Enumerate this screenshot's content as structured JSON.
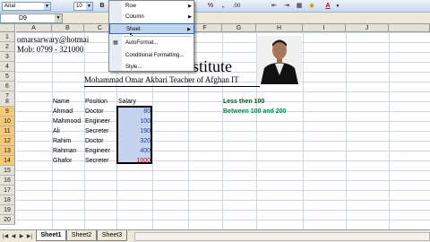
{
  "toolbar": {
    "font_name": "Arial",
    "font_size": "10",
    "currency_symbol": "%",
    "buttons": [
      "%",
      ",",
      ".00",
      "B",
      "A"
    ]
  },
  "formula_bar": {
    "cell_ref": "D9"
  },
  "columns": [
    "A",
    "B",
    "C",
    "D",
    "E",
    "F",
    "G",
    "H",
    "I",
    "J"
  ],
  "rows": [
    "1",
    "2",
    "3",
    "4",
    "5",
    "6",
    "7",
    "8",
    "9",
    "10",
    "11",
    "12",
    "13",
    "14",
    "15",
    "16",
    "17",
    "18",
    "19",
    "20",
    "21",
    "22"
  ],
  "selected_rows": [
    "9",
    "10",
    "11",
    "12",
    "13",
    "14"
  ],
  "header_text": {
    "email": "omarsarwary@hotmai",
    "mobile": "Mob: 0799 - 321000",
    "institute": "stitute",
    "teacher": "Mohammad Omar Akbari Teacher of Afghan IT"
  },
  "table": {
    "headers": {
      "name": "Name",
      "position": "Position",
      "salary": "Salary"
    },
    "rows": [
      {
        "name": "Ahmad",
        "position": "Doctor",
        "salary": "80"
      },
      {
        "name": "Mahmood",
        "position": "Engineer",
        "salary": "100"
      },
      {
        "name": "Ali",
        "position": "Secreter",
        "salary": "190"
      },
      {
        "name": "Rahim",
        "position": "Doctor",
        "salary": "320"
      },
      {
        "name": "Rahman",
        "position": "Engineer",
        "salary": "400"
      },
      {
        "name": "Ghafor",
        "position": "Secreter",
        "salary": "1000"
      }
    ]
  },
  "notes": {
    "less_than": "Less then 100",
    "between": "Between 100 and 200"
  },
  "colors": {
    "salary_normal": "#1f3fa8",
    "salary_high": "#e01010",
    "note_less": "#0a5a1a",
    "note_between": "#0a8a4a"
  },
  "format_menu": {
    "items": [
      {
        "label": "Row",
        "submenu": true
      },
      {
        "label": "Column",
        "submenu": true
      },
      {
        "label": "Sheet",
        "submenu": true,
        "highlighted": true
      },
      {
        "label": "AutoFormat...",
        "submenu": false
      },
      {
        "label": "Conditional Formatting...",
        "submenu": false
      },
      {
        "label": "Style...",
        "submenu": false
      }
    ]
  },
  "sheet_tabs": [
    {
      "label": "Sheet1",
      "active": true
    },
    {
      "label": "Sheet2",
      "active": false
    },
    {
      "label": "Sheet3",
      "active": false
    }
  ]
}
